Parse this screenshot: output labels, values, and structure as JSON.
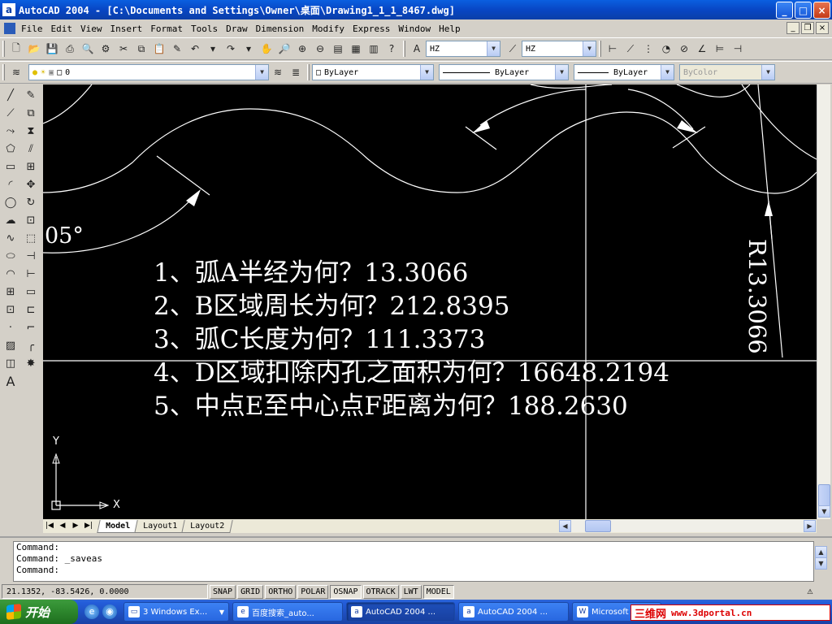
{
  "window": {
    "title": "AutoCAD 2004 - [C:\\Documents and Settings\\Owner\\桌面\\Drawing1_1_1_8467.dwg]",
    "app_icon": "a",
    "minimize": "_",
    "maximize": "□",
    "close": "×"
  },
  "menu": {
    "items": [
      "File",
      "Edit",
      "View",
      "Insert",
      "Format",
      "Tools",
      "Draw",
      "Dimension",
      "Modify",
      "Express",
      "Window",
      "Help"
    ],
    "mdi_minimize": "_",
    "mdi_restore": "❐",
    "mdi_close": "×"
  },
  "toolbar": {
    "text_style": "HZ",
    "dim_style": "HZ",
    "layer": "0",
    "color": "ByLayer",
    "linetype": "ByLayer",
    "lineweight": "ByLayer",
    "plotstyle": "ByColor"
  },
  "drawing": {
    "questions": [
      "1、弧A半经为何？13.3066",
      "2、B区域周长为何？212.8395",
      "3、弧C长度为何？111.3373",
      "4、D区域扣除内孔之面积为何？16648.2194",
      "5、中点E至中心点F距离为何？188.2630"
    ],
    "radius_label": "R13.3066",
    "angle_label": "05°",
    "ucs_x": "X",
    "ucs_y": "Y"
  },
  "tabs": [
    "Model",
    "Layout1",
    "Layout2"
  ],
  "tab_nav": [
    "|◀",
    "◀",
    "▶",
    "▶|"
  ],
  "command": {
    "lines": [
      "Command:",
      "Command: _saveas",
      "Command:"
    ]
  },
  "status": {
    "coords": "21.1352, -83.5426, 0.0000",
    "buttons": [
      {
        "label": "SNAP",
        "on": false
      },
      {
        "label": "GRID",
        "on": false
      },
      {
        "label": "ORTHO",
        "on": false
      },
      {
        "label": "POLAR",
        "on": false
      },
      {
        "label": "OSNAP",
        "on": true
      },
      {
        "label": "OTRACK",
        "on": false
      },
      {
        "label": "LWT",
        "on": false
      },
      {
        "label": "MODEL",
        "on": true
      }
    ]
  },
  "taskbar": {
    "start": "开始",
    "tasks": [
      {
        "label": "3 Windows Ex...",
        "icon": "folder-icon"
      },
      {
        "label": "百度搜索_auto...",
        "icon": "ie-icon"
      },
      {
        "label": "AutoCAD 2004 ...",
        "icon": "autocad-icon",
        "active": true
      },
      {
        "label": "AutoCAD 2004 ...",
        "icon": "autocad-icon"
      },
      {
        "label": "Microsoft ...",
        "icon": "word-icon"
      }
    ],
    "watermark_cn": "三维网",
    "watermark_url": "www.3dportal.cn"
  },
  "colors": {
    "canvas": "#000000",
    "title_blue": "#0a3fa8",
    "taskbar": "#245edb"
  }
}
